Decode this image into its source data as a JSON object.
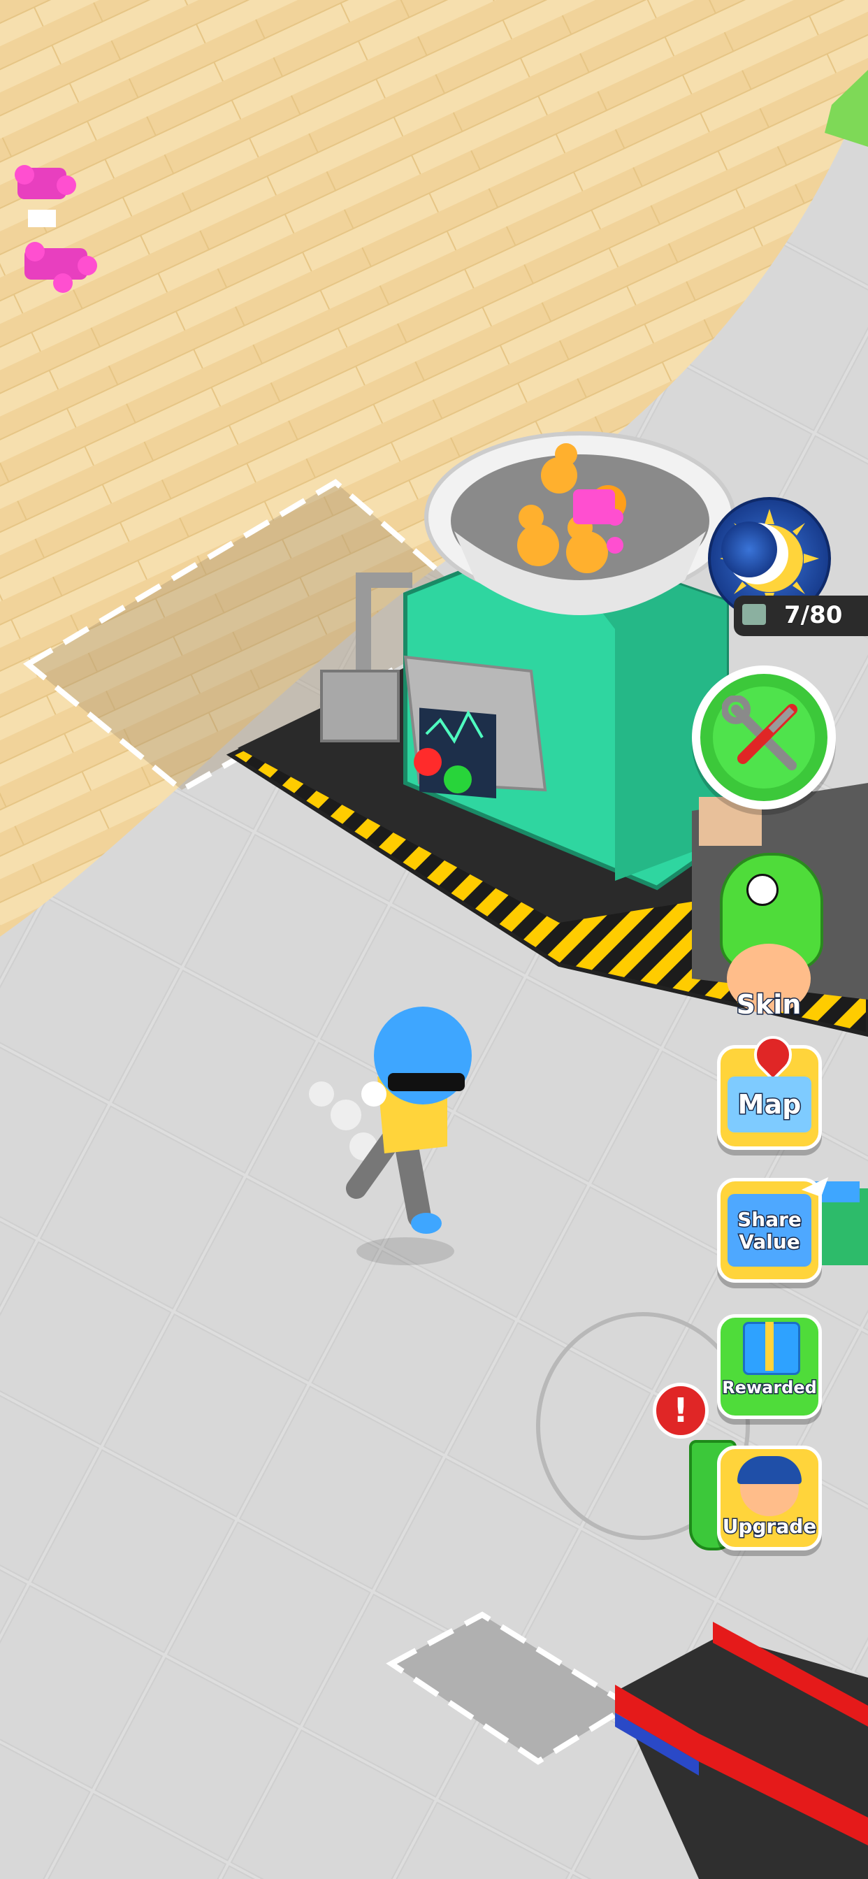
{
  "hud": {
    "capacity_counter": "7/80",
    "day_night_icon": "sun-moon-icon",
    "build_button_icon": "tools-icon",
    "skin_label": "Skin",
    "map_label": "Map",
    "share_value_label_line1": "Share",
    "share_value_label_line2": "Value",
    "rewarded_label": "Rewarded",
    "upgrade_label": "Upgrade",
    "alert_badge": "!"
  },
  "colors": {
    "floor_wood": "#f3d9a4",
    "floor_concrete": "#dcdcdc",
    "machine_green": "#2fd6a0",
    "hud_blue": "#1f4fa8",
    "hud_yellow": "#ffd43b",
    "hud_green": "#3cc83a",
    "alert_red": "#e02626"
  }
}
